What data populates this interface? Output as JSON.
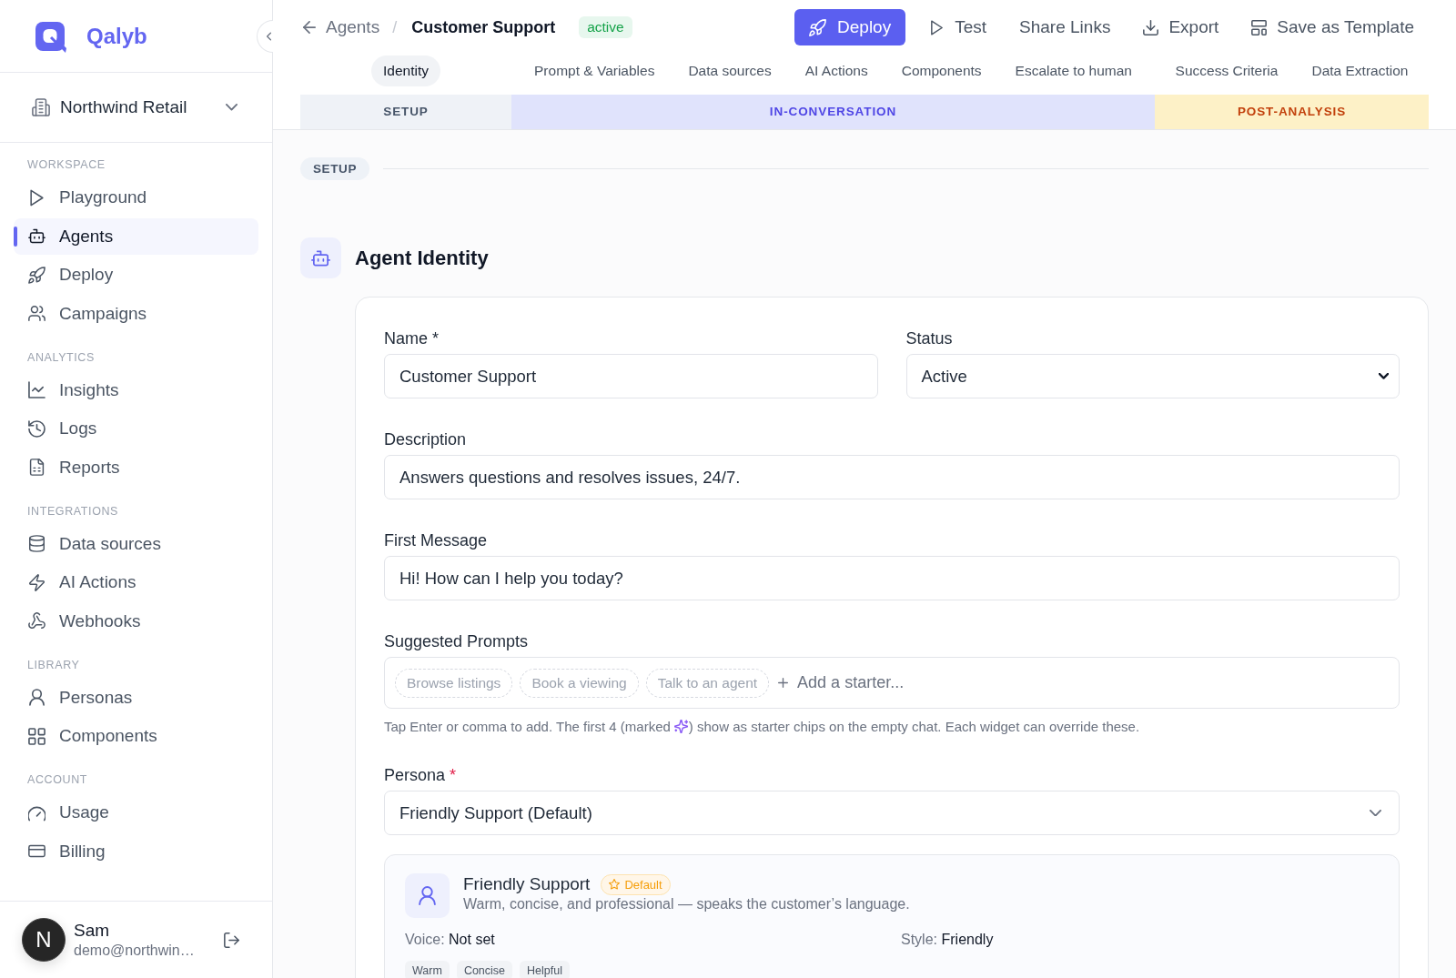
{
  "sidebar": {
    "brand": "Qalyb",
    "workspace": "Northwind Retail",
    "sections": [
      {
        "title": "WORKSPACE",
        "items": [
          {
            "label": "Playground",
            "selected": false
          },
          {
            "label": "Agents",
            "selected": true
          },
          {
            "label": "Deploy",
            "selected": false
          },
          {
            "label": "Campaigns",
            "selected": false
          }
        ]
      },
      {
        "title": "ANALYTICS",
        "items": [
          {
            "label": "Insights",
            "selected": false
          },
          {
            "label": "Logs",
            "selected": false
          },
          {
            "label": "Reports",
            "selected": false
          }
        ]
      },
      {
        "title": "INTEGRATIONS",
        "items": [
          {
            "label": "Data sources",
            "selected": false
          },
          {
            "label": "AI Actions",
            "selected": false
          },
          {
            "label": "Webhooks",
            "selected": false
          }
        ]
      },
      {
        "title": "LIBRARY",
        "items": [
          {
            "label": "Personas",
            "selected": false
          },
          {
            "label": "Components",
            "selected": false
          }
        ]
      },
      {
        "title": "ACCOUNT",
        "items": [
          {
            "label": "Usage",
            "selected": false
          },
          {
            "label": "Billing",
            "selected": false
          }
        ]
      }
    ],
    "user": {
      "avatar_initial": "N",
      "name": "Sam",
      "email": "demo@northwin…"
    }
  },
  "header": {
    "breadcrumb": {
      "back": "Agents",
      "separator": "/",
      "current": "Customer Support"
    },
    "status_badge": "active",
    "actions": [
      {
        "label": "Deploy",
        "kind": "primary"
      },
      {
        "label": "Test",
        "kind": "plain"
      },
      {
        "label": "Share Links",
        "kind": "plain"
      },
      {
        "label": "Export",
        "kind": "plain"
      },
      {
        "label": "Save as Template",
        "kind": "plain"
      }
    ]
  },
  "phases": [
    {
      "label": "SETUP",
      "kind": "setup",
      "tabs": [
        {
          "label": "Identity",
          "selected": true
        }
      ]
    },
    {
      "label": "IN-CONVERSATION",
      "kind": "conversation",
      "tabs": [
        {
          "label": "Prompt & Variables",
          "selected": false
        },
        {
          "label": "Data sources",
          "selected": false
        },
        {
          "label": "AI Actions",
          "selected": false
        },
        {
          "label": "Components",
          "selected": false
        },
        {
          "label": "Escalate to human",
          "selected": false
        }
      ]
    },
    {
      "label": "POST-ANALYSIS",
      "kind": "analysis",
      "tabs": [
        {
          "label": "Success Criteria",
          "selected": false
        },
        {
          "label": "Data Extraction",
          "selected": false
        }
      ]
    }
  ],
  "section_divider": "SETUP",
  "agent_identity": {
    "title": "Agent Identity",
    "name": {
      "label": "Name *",
      "value": "Customer Support"
    },
    "status": {
      "label": "Status",
      "value": "Active"
    },
    "description": {
      "label": "Description",
      "value": "Answers questions and resolves issues, 24/7."
    },
    "first_message": {
      "label": "First Message",
      "value": "Hi! How can I help you today?"
    },
    "suggested_prompts": {
      "label": "Suggested Prompts",
      "chips": [
        "Browse listings",
        "Book a viewing",
        "Talk to an agent"
      ],
      "placeholder": "Add a starter...",
      "hint": [
        "Tap Enter or comma to add. The first 4 (marked",
        ") show as starter chips on the empty chat. Each widget can override these."
      ]
    },
    "persona": {
      "label": "Persona",
      "required_mark": "*",
      "value": "Friendly Support (Default)",
      "card": {
        "name": "Friendly Support",
        "badge": "Default",
        "description": "Warm, concise, and professional — speaks the customer’s language.",
        "details": [
          {
            "label": "Voice:",
            "value": "Not set"
          },
          {
            "label": "Style:",
            "value": "Friendly"
          }
        ],
        "tags": [
          "Warm",
          "Concise",
          "Helpful"
        ]
      }
    }
  }
}
